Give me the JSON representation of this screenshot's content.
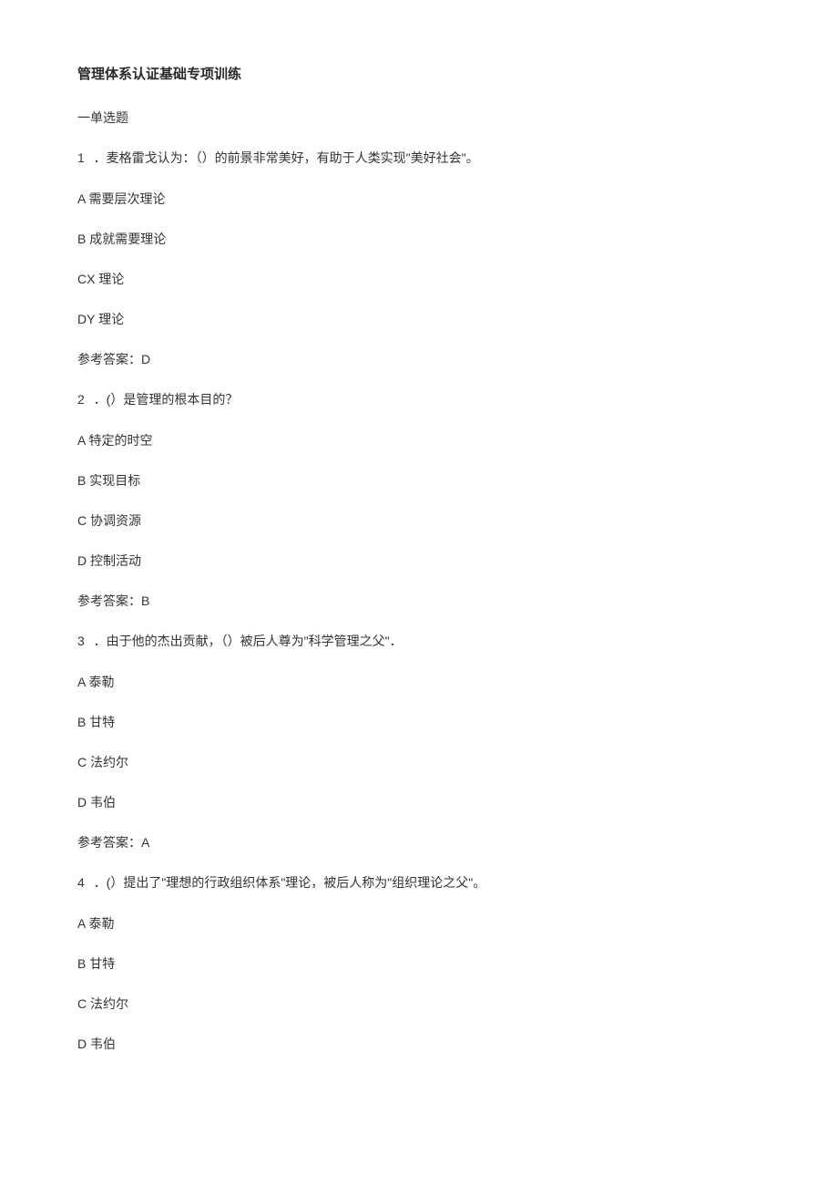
{
  "title": "管理体系认证基础专项训练",
  "section": "一单选题",
  "questions": [
    {
      "num": "1",
      "stem": "．麦格雷戈认为：（）的前景非常美好，有助于人类实现\"美好社会\"。",
      "opts": {
        "A": "A 需要层次理论",
        "B": "B 成就需要理论",
        "C": "CX 理论",
        "D": "DY 理论"
      },
      "ans": "参考答案：D"
    },
    {
      "num": "2",
      "stem": "．(）是管理的根本目的？",
      "opts": {
        "A": "A 特定的时空",
        "B": "B 实现目标",
        "C": "C 协调资源",
        "D": "D 控制活动"
      },
      "ans": "参考答案：B"
    },
    {
      "num": "3",
      "stem": "．由于他的杰出贡献，（）被后人尊为\"科学管理之父\"．",
      "opts": {
        "A": "A 泰勒",
        "B": "B 甘特",
        "C": "C 法约尔",
        "D": "D 韦伯"
      },
      "ans": "参考答案：A"
    },
    {
      "num": "4",
      "stem": "．(）提出了\"理想的行政组织体系\"理论，被后人称为\"组织理论之父\"。",
      "opts": {
        "A": "A 泰勒",
        "B": "B 甘特",
        "C": "C 法约尔",
        "D": "D 韦伯"
      },
      "ans": ""
    }
  ]
}
